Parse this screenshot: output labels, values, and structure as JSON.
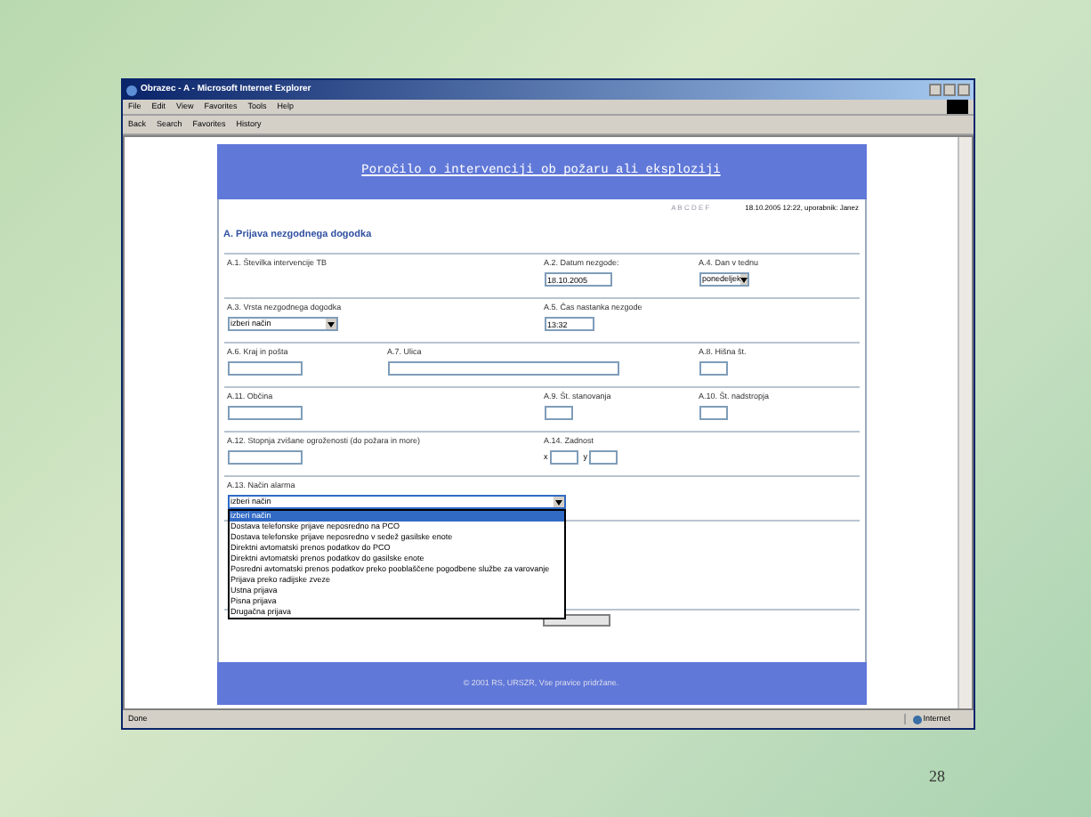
{
  "window": {
    "title": "Obrazec - A - Microsoft Internet Explorer"
  },
  "menu": [
    "File",
    "Edit",
    "View",
    "Favorites",
    "Tools",
    "Help"
  ],
  "toolbar": [
    "Back",
    "Search",
    "Favorites",
    "History"
  ],
  "page": {
    "banner": "Poročilo o intervenciji ob požaru ali eksploziji",
    "steps": "A B C D E F",
    "timestamp": "18.10.2005 12:22, uporabnik: Janez",
    "section": "A. Prijava nezgodnega dogodka",
    "rows": [
      [
        {
          "label": "A.1. Številka intervencije TB"
        },
        {
          "label": "A.2. Datum nezgode:",
          "kind": "text",
          "value": "18.10.2005"
        },
        {
          "label": "A.4. Dan v tednu",
          "kind": "select",
          "value": "ponedeljek",
          "expanded": false
        }
      ],
      [
        {
          "label": "A.3. Vrsta nezgodnega dogodka",
          "kind": "select",
          "value": "izberi način",
          "expanded": false
        },
        {
          "label": "A.5. Čas nastanka nezgode",
          "kind": "text",
          "value": "13:32"
        }
      ],
      [
        {
          "label": "A.6. Kraj in pošta",
          "kind": "text"
        },
        {
          "label": "A.7. Ulica",
          "kind": "text"
        },
        {
          "label": "A.8. Hišna št.",
          "kind": "text"
        }
      ],
      [
        {
          "label": "A.11. Občina",
          "kind": "text"
        },
        {
          "label": "A.9. Št. stanovanja",
          "kind": "text"
        },
        {
          "label": "A.10. Št. nadstropja",
          "kind": "text"
        }
      ],
      [
        {
          "label": "A.12. Stopnja zvišane ogroženosti (do požara in more)",
          "kind": "text"
        },
        {
          "label": "A.14. Zadnost",
          "kind": "pair",
          "prefixes": [
            "x",
            "y"
          ]
        }
      ],
      [
        {
          "label": "A.13. Način alarma",
          "kind": "select",
          "value": "izberi način",
          "expanded": true,
          "options": [
            {
              "text": "izberi način",
              "selected": true
            },
            {
              "text": "Dostava telefonske prijave neposredno na PCO",
              "selected": false
            },
            {
              "text": "Dostava telefonske prijave neposredno v sedež gasilske enote",
              "selected": false
            },
            {
              "text": "Direktni avtomatski prenos podatkov do PCO",
              "selected": false
            },
            {
              "text": "Direktni avtomatski prenos podatkov do gasilske enote",
              "selected": false
            },
            {
              "text": "Posredni avtomatski prenos podatkov preko pooblaščene pogodbene službe za varovanje",
              "selected": false
            },
            {
              "text": "Prijava preko radijske zveze",
              "selected": false
            },
            {
              "text": "Ustna prijava",
              "selected": false
            },
            {
              "text": "Pisna prijava",
              "selected": false
            },
            {
              "text": "Drugačna prijava",
              "selected": false
            }
          ]
        }
      ]
    ],
    "footer": "© 2001 RS, URSZR, Vse pravice pridržane."
  },
  "status_bar": {
    "left": "Done",
    "zone": "Internet"
  },
  "slide_number": "28"
}
